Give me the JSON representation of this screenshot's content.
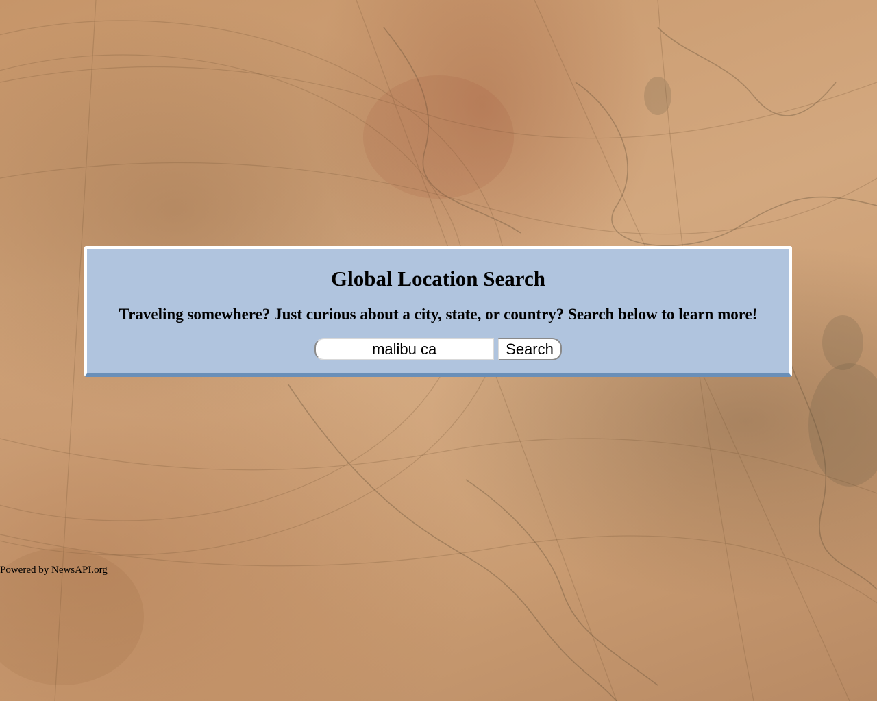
{
  "panel": {
    "title": "Global Location Search",
    "subtitle": "Traveling somewhere? Just curious about a city, state, or country? Search below to learn more!",
    "background_color": "#b0c4de",
    "accent_color": "#6a8fb8"
  },
  "search": {
    "value": "malibu ca",
    "button_label": "Search"
  },
  "footer": {
    "attribution": "Powered by NewsAPI.org"
  },
  "background": {
    "description_icon": "antique-map-background",
    "base_color": "#c99a6e"
  }
}
